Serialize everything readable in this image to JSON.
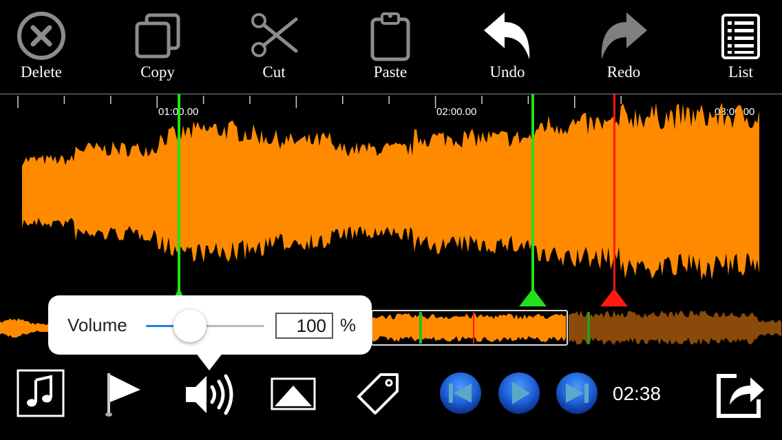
{
  "toolbar": {
    "items": [
      {
        "label": "Delete",
        "icon": "delete-circle-icon"
      },
      {
        "label": "Copy",
        "icon": "copy-icon"
      },
      {
        "label": "Cut",
        "icon": "scissors-icon"
      },
      {
        "label": "Paste",
        "icon": "clipboard-icon"
      },
      {
        "label": "Undo",
        "icon": "undo-arrow-icon"
      },
      {
        "label": "Redo",
        "icon": "redo-arrow-icon"
      },
      {
        "label": "List",
        "icon": "list-icon"
      }
    ]
  },
  "timeline": {
    "labels": [
      "01:00.00",
      "02:00.00",
      "03:00.00"
    ]
  },
  "markers": {
    "start_color": "#22e01a",
    "end_color": "#22e01a",
    "playhead_color": "#ff1a0d"
  },
  "waveform": {
    "color": "#ff8a00",
    "overview_dim_color": "#8a4a0a"
  },
  "volume_popup": {
    "label": "Volume",
    "value": "100",
    "unit": "%",
    "slider_fraction": 0.37
  },
  "bottom_bar": {
    "time": "02:38",
    "icons": [
      "music-note-icon",
      "flag-icon",
      "speaker-volume-icon",
      "image-icon",
      "tag-icon",
      "skip-back-icon",
      "play-icon",
      "skip-forward-icon",
      "share-icon"
    ]
  },
  "colors": {
    "background": "#000000",
    "accent_blue": "#1f7cf5",
    "transport_blue": "#1e5fd6"
  }
}
